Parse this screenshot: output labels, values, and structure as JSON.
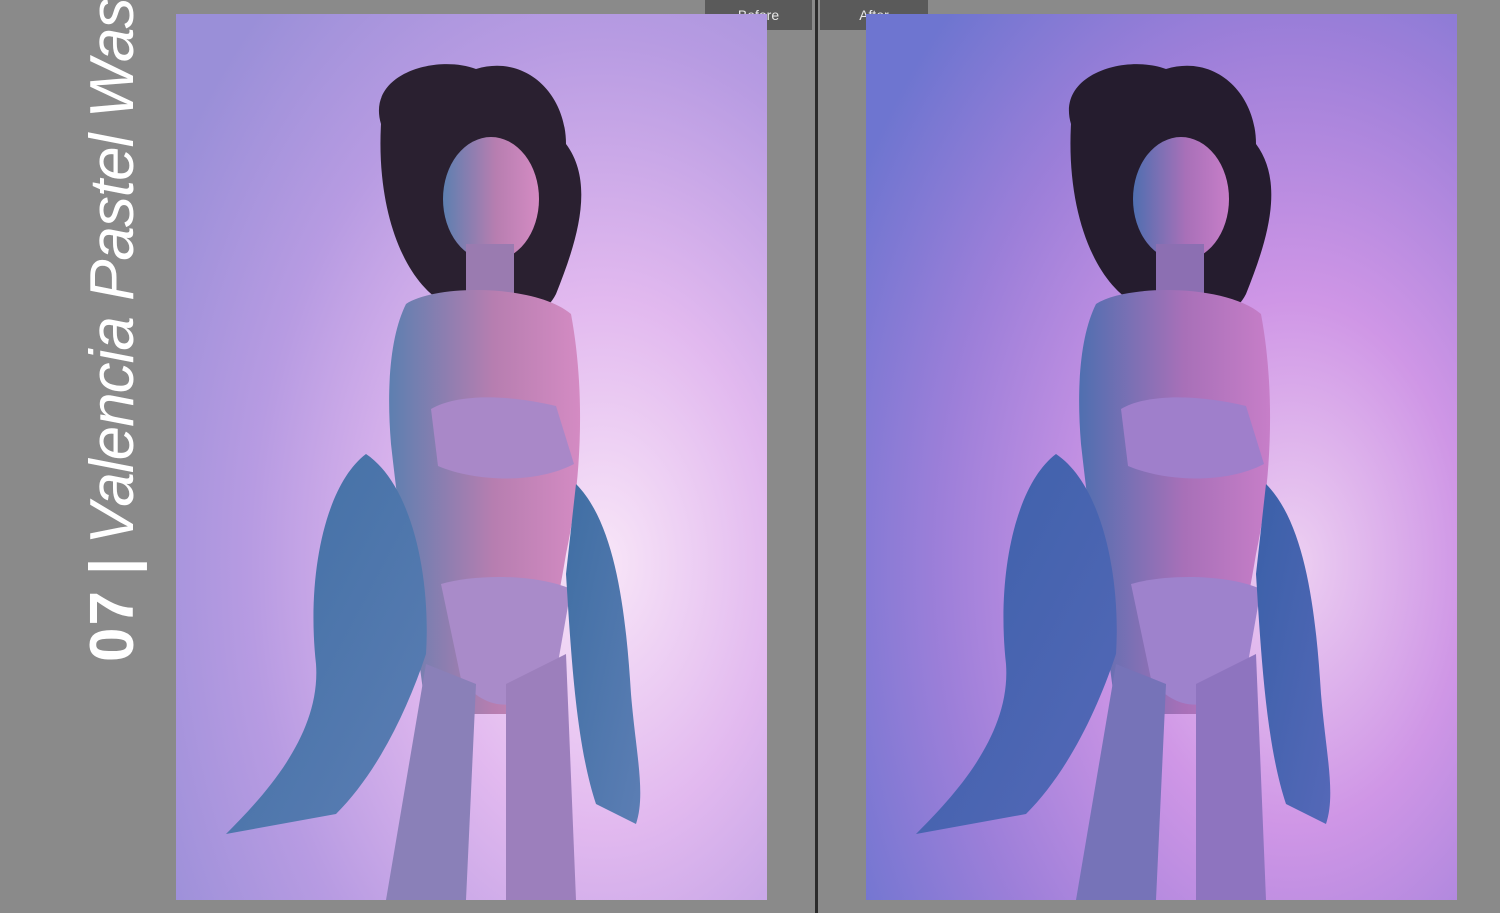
{
  "title": {
    "number": "07",
    "separator": "|",
    "name": "Valencia Pastel Wash"
  },
  "panels": {
    "before": {
      "label": "Before",
      "bg_top_left": "#a99be0",
      "bg_center": "#f3dcf5",
      "bg_right": "#c17fe0"
    },
    "after": {
      "label": "After",
      "bg_top_left": "#6f74d2",
      "bg_center": "#e7c8f0",
      "bg_right": "#b363d8"
    }
  },
  "colors": {
    "workspace": "#8a8a8a",
    "divider": "#2b2b2b",
    "tab_bg": "#5a5a5a",
    "tab_text": "#e8e8e8",
    "title_text": "#ffffff"
  }
}
